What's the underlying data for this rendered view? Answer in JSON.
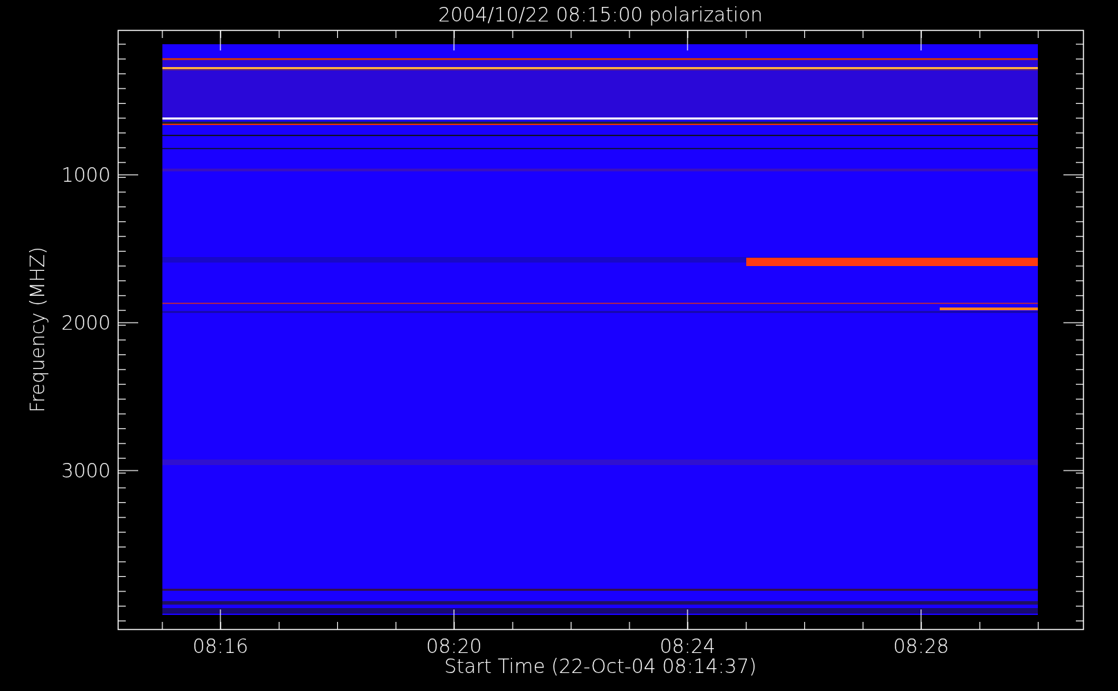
{
  "plot": {
    "title": "2004/10/22 08:15:00 polarization",
    "xlabel": "Start Time (22-Oct-04 08:14:37)",
    "ylabel": "Frequency (MHZ)",
    "xtick_labels": [
      "08:16",
      "08:20",
      "08:24",
      "08:28"
    ],
    "ytick_labels": [
      "1000",
      "2000",
      "3000"
    ]
  }
}
